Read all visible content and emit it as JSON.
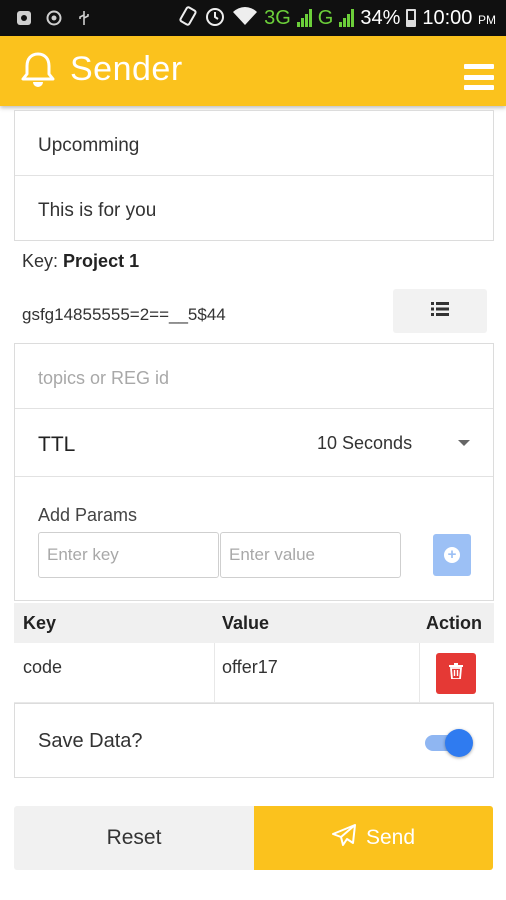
{
  "status_bar": {
    "network_type_1": "3G",
    "network_type_2": "G",
    "battery": "34%",
    "time": "10:00",
    "ampm": "PM",
    "icons": [
      "notification-icon",
      "location-icon",
      "usb-icon",
      "rotate-icon",
      "alarm-icon",
      "wifi-icon",
      "signal-icon",
      "battery-icon"
    ]
  },
  "app_bar": {
    "title": "Sender",
    "icon": "bell-icon",
    "menu_icon": "hamburger-menu-icon",
    "color": "#fbc21d"
  },
  "message": {
    "title": "Upcomming",
    "body": "This is for you"
  },
  "key": {
    "label": "Key:",
    "project": "Project 1",
    "token": "gsfg14855555=2==__5$44",
    "list_icon": "list-icon"
  },
  "target": {
    "placeholder": "topics or REG id"
  },
  "ttl": {
    "label": "TTL",
    "value": "10 Seconds"
  },
  "params": {
    "label": "Add Params",
    "key_placeholder": "Enter key",
    "value_placeholder": "Enter value",
    "add_icon": "add-circle-icon"
  },
  "table": {
    "headers": [
      "Key",
      "Value",
      "Action"
    ],
    "rows": [
      {
        "key": "code",
        "value": "offer17",
        "action_icon": "trash-icon"
      }
    ]
  },
  "save": {
    "label": "Save Data?",
    "enabled": true,
    "toggle_color": "#2f7bf0"
  },
  "actions": {
    "reset": "Reset",
    "send": "Send",
    "send_icon": "paper-plane-icon",
    "delete_color": "#e53935"
  }
}
